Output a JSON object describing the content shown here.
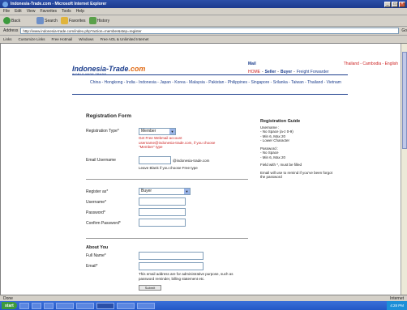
{
  "window": {
    "title": "Indonesia-Trade.com - Microsoft Internet Explorer",
    "controls": [
      "_",
      "□",
      "×"
    ]
  },
  "menu": [
    "File",
    "Edit",
    "View",
    "Favorites",
    "Tools",
    "Help"
  ],
  "toolbar": {
    "back": "Back",
    "search": "Search",
    "favorites": "Favorites",
    "history": "History"
  },
  "address": {
    "label": "Address",
    "url": "http://www.indonesia-trade.com/index.php?action=member&step=register",
    "go": "Go"
  },
  "links_bar": {
    "label": "Links",
    "items": [
      "Customize Links",
      "Free Hotmail",
      "Windows",
      "Free AOL & Unlimited Internet"
    ]
  },
  "site": {
    "brand_main": "Indonesia-Trade",
    "brand_suffix": ".com",
    "tagline": "WORLD WIDE TRADE",
    "topright": {
      "left": "Mail",
      "langs": "Thailand - Cambodia - English"
    },
    "nav": {
      "home": "HOME",
      "seller": "Seller",
      "buyer": "Buyer",
      "freight": "Freight Forwarder"
    },
    "countries": "China - Hongkong - India - Indonesia - Japan - Korea - Malaysia - Pakistan - Philippines - Singapore - Srilanka - Taiwan - Thailand - Vietnam"
  },
  "form": {
    "title": "Registration Form",
    "registration_type_label": "Registration Type*",
    "registration_type_value": "Member",
    "registration_type_note": "Get Free Webmail account username@indonesia-trade.com, if you choose \"Member\" type",
    "email_username_label": "Email Username",
    "email_username_suffix": "@indonesia-trade.com",
    "email_username_note": "Leave Blank if you choose Free type",
    "register_as_label": "Register as*",
    "register_as_value": "Buyer",
    "username_label": "Username*",
    "password_label": "Password*",
    "confirm_password_label": "Confirm Password*",
    "about_title": "About You",
    "fullname_label": "Full Name*",
    "email_label": "Email*",
    "email_note": "This email address are for administrative purpose, such as password reminder, billing statement etc.",
    "submit": "Submit"
  },
  "guide": {
    "title": "Registration Guide",
    "username_head": "Username :",
    "username_rules": [
      "- No Space (a-z 0-9)",
      "- Min 6, Max 20",
      "- Lower Character"
    ],
    "password_head": "Password :",
    "password_rules": [
      "- No Space",
      "- Min 6, Max 20"
    ],
    "required_note": "Field with *, must be filled",
    "email_note": "Email will use to remind if you've been forgot the password"
  },
  "status": {
    "left": "Done",
    "right": "Internet"
  },
  "taskbar": {
    "start": "start",
    "clock": "4:28 PM"
  }
}
